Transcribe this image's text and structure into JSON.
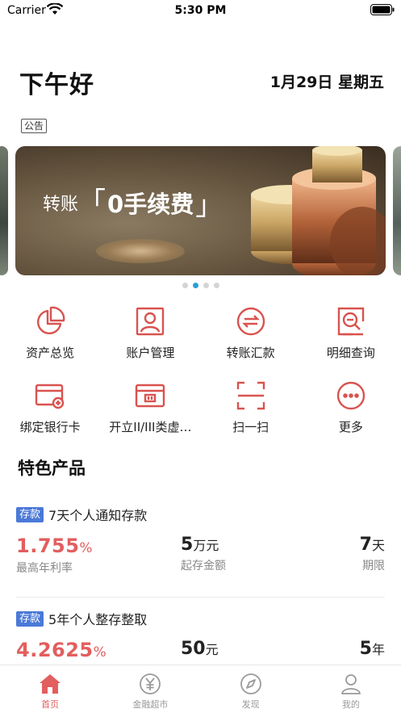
{
  "status_bar": {
    "carrier": "Carrier",
    "time": "5:30 PM"
  },
  "header": {
    "greeting": "下午好",
    "date": "1月29日  星期五",
    "notice_badge": "公告"
  },
  "banner": {
    "prefix": "转账",
    "highlight": "0手续费",
    "bracket_open": "「",
    "bracket_close": "」",
    "page_count": 4,
    "active_page": 1
  },
  "services": [
    {
      "label": "资产总览",
      "icon": "pie-chart-icon"
    },
    {
      "label": "账户管理",
      "icon": "account-icon"
    },
    {
      "label": "转账汇款",
      "icon": "transfer-icon"
    },
    {
      "label": "明细查询",
      "icon": "detail-search-icon"
    },
    {
      "label": "绑定银行卡",
      "icon": "bind-card-icon"
    },
    {
      "label": "开立II/III类虚…",
      "icon": "virtual-card-icon"
    },
    {
      "label": "扫一扫",
      "icon": "scan-icon"
    },
    {
      "label": "更多",
      "icon": "more-icon"
    }
  ],
  "section_title": "特色产品",
  "products": [
    {
      "tag": "存款",
      "name": "7天个人通知存款",
      "rate_value": "1.755",
      "rate_unit": "%",
      "rate_label": "最高年利率",
      "min_value": "5",
      "min_unit": "万元",
      "min_label": "起存金额",
      "term_value": "7",
      "term_unit": "天",
      "term_label": "期限"
    },
    {
      "tag": "存款",
      "name": "5年个人整存整取",
      "rate_value": "4.2625",
      "rate_unit": "%",
      "min_value": "50",
      "min_unit": "元",
      "term_value": "5",
      "term_unit": "年"
    }
  ],
  "tabbar": [
    {
      "label": "首页",
      "icon": "home-icon",
      "active": true
    },
    {
      "label": "金融超市",
      "icon": "yuan-icon",
      "active": false
    },
    {
      "label": "发现",
      "icon": "compass-icon",
      "active": false
    },
    {
      "label": "我的",
      "icon": "user-icon",
      "active": false
    }
  ],
  "colors": {
    "accent_red": "#e35e5e",
    "tag_blue": "#4a79d8",
    "dot_active": "#2a9fd8"
  }
}
